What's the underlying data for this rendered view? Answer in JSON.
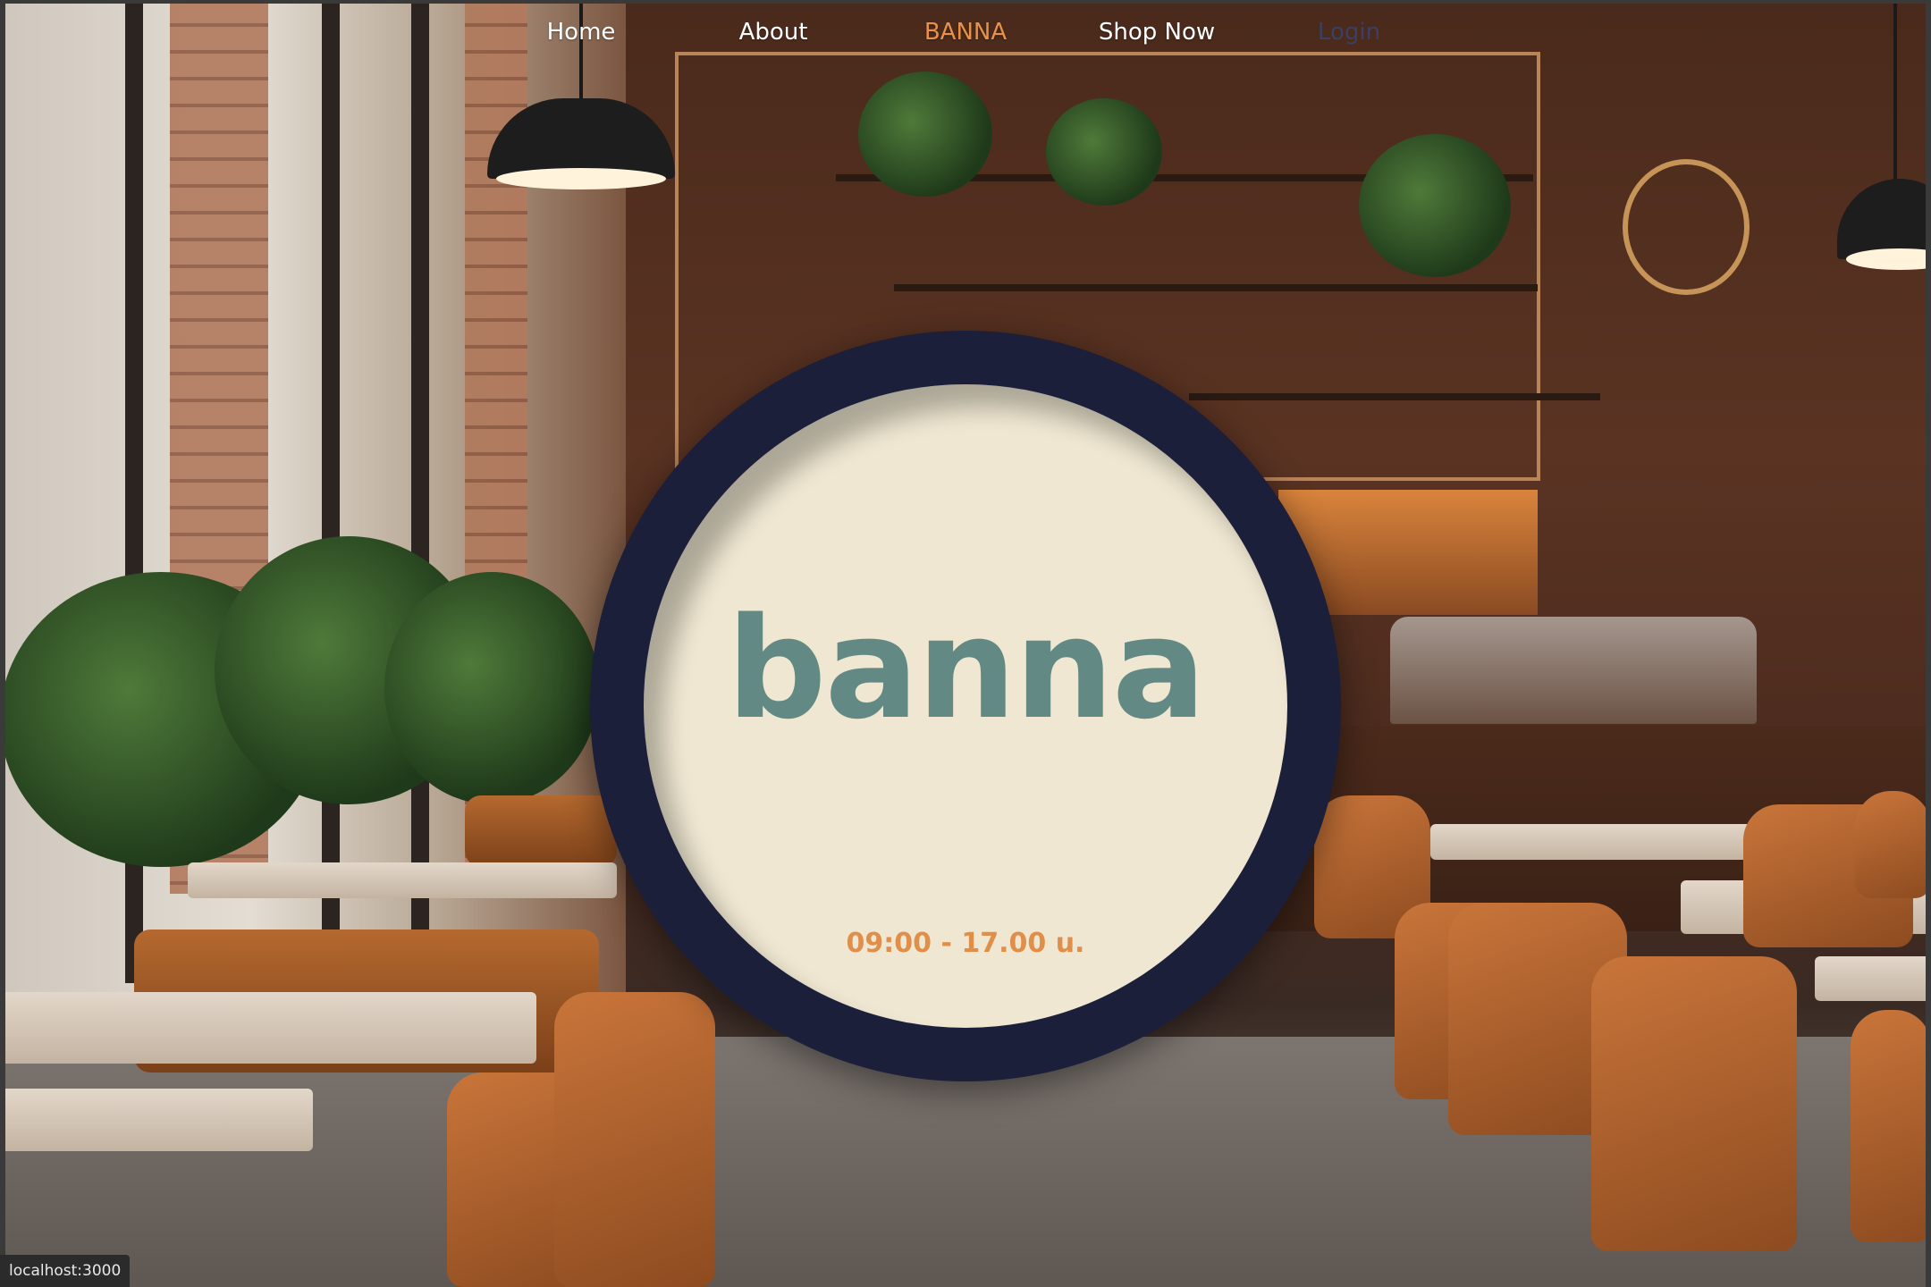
{
  "nav": {
    "items": [
      {
        "label": "Home"
      },
      {
        "label": "About"
      },
      {
        "label": "BANNA",
        "active": true
      },
      {
        "label": "Shop Now"
      },
      {
        "label": "Login"
      }
    ]
  },
  "hero": {
    "brand": "banna",
    "hours": "09:00 - 17.00 u."
  },
  "status_bar": {
    "url": "localhost:3000"
  },
  "colors": {
    "nav_text": "#ffffff",
    "nav_active": "#e89148",
    "nav_login": "#3c3f63",
    "badge_ring": "#1b1f3a",
    "badge_fill": "#efe7d1",
    "brand_text": "#628983",
    "hours_text": "#e08f4a"
  },
  "background": {
    "description_icon": "cafe-interior-image"
  }
}
